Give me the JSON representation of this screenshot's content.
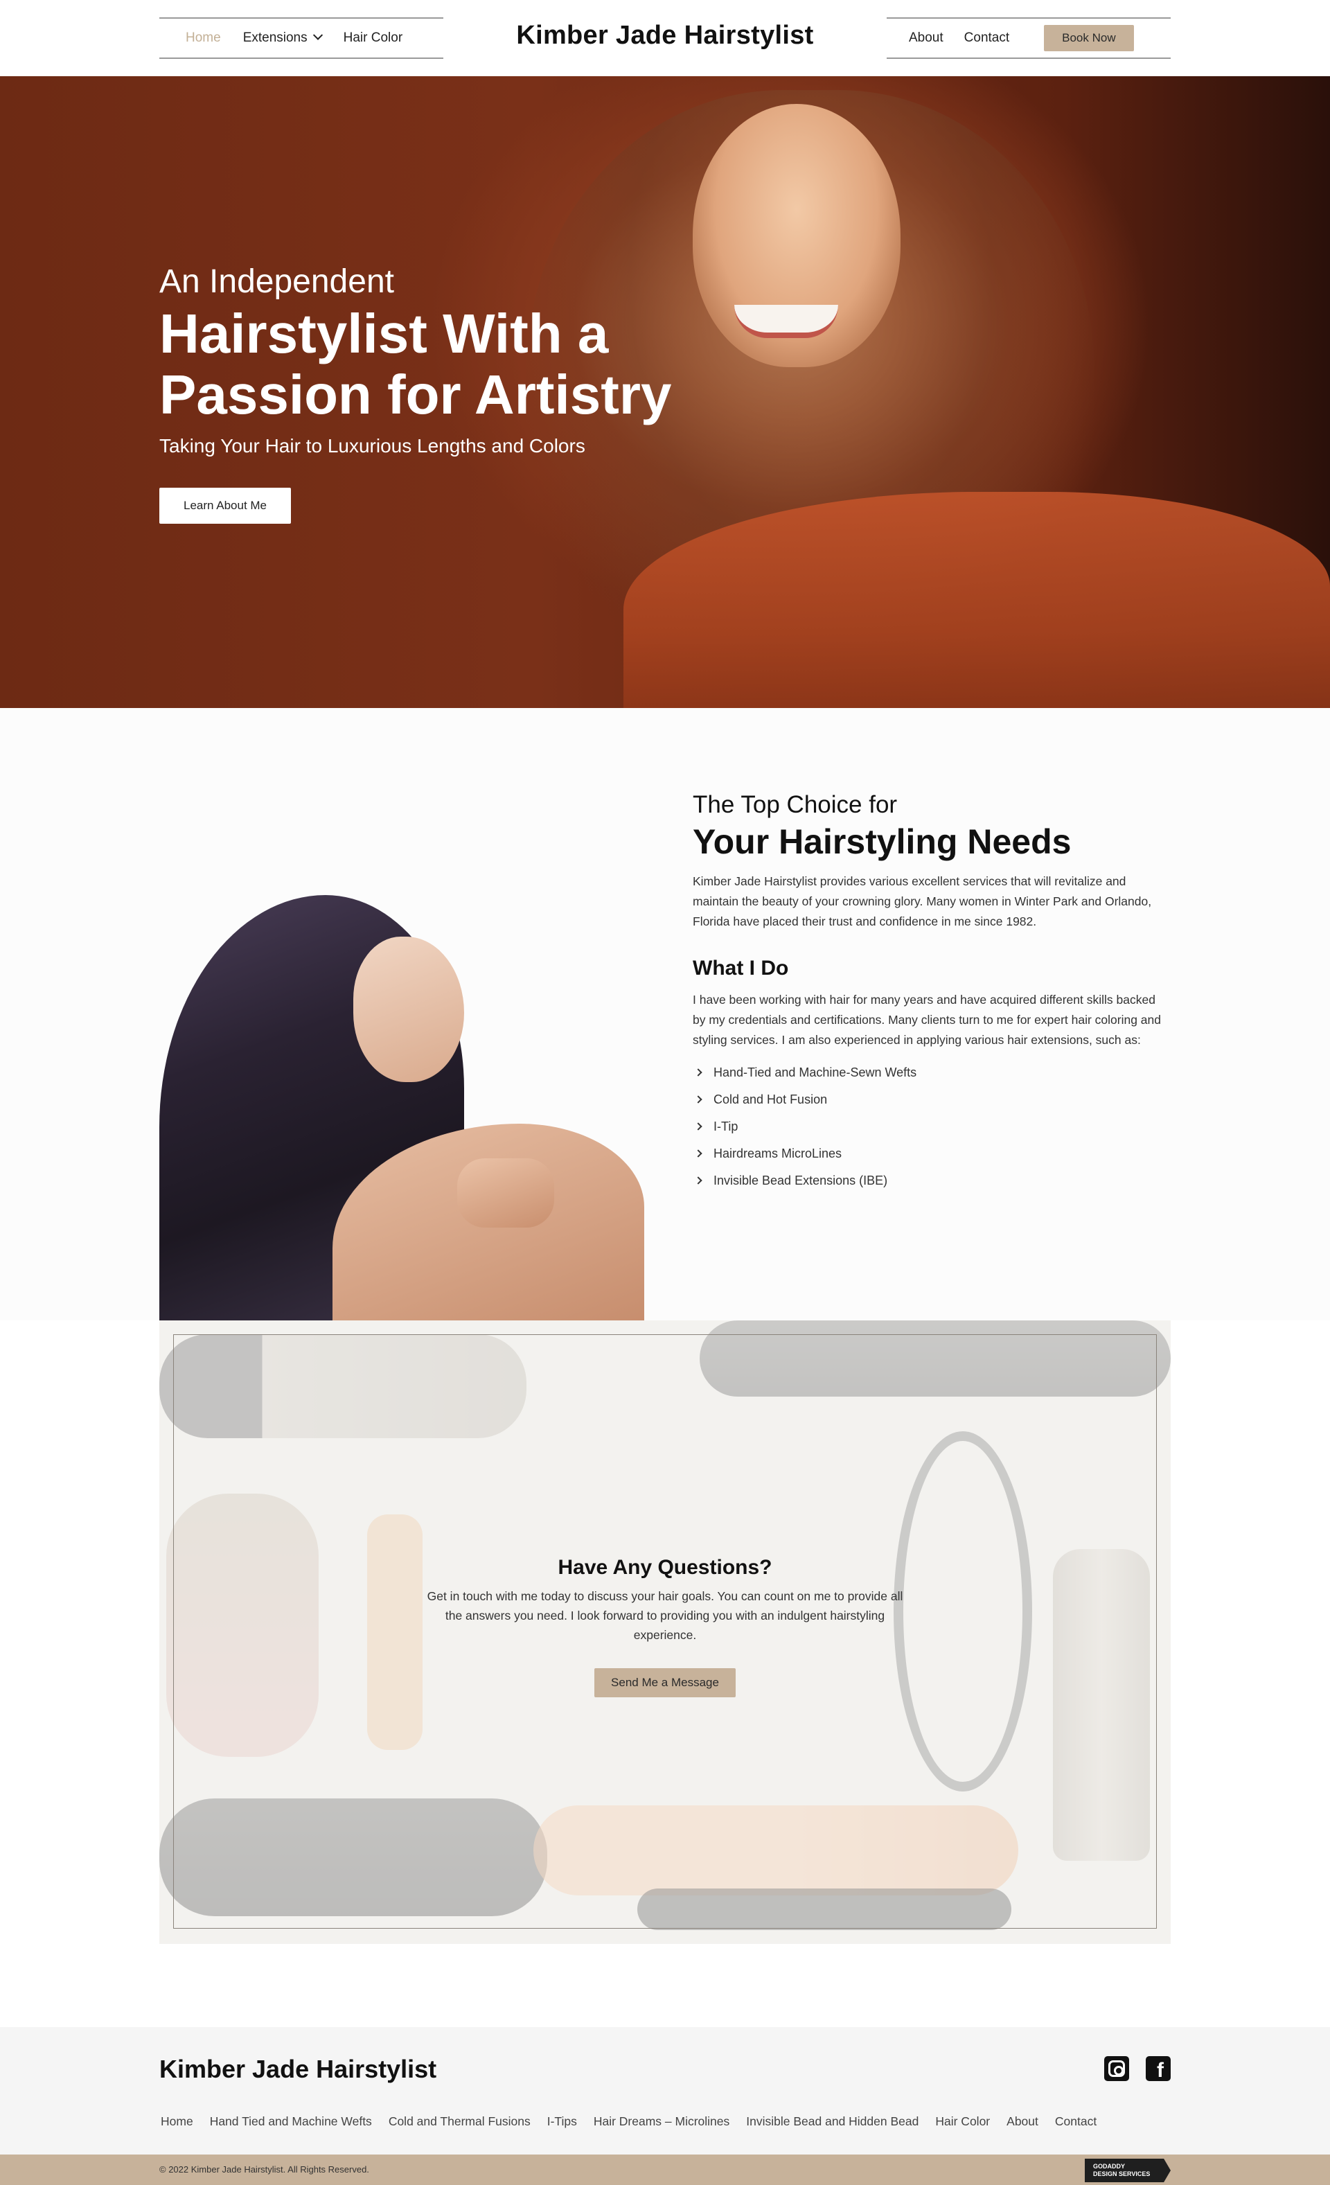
{
  "header": {
    "brand": "Kimber Jade Hairstylist",
    "nav_left": [
      {
        "label": "Home",
        "active": true
      },
      {
        "label": "Extensions",
        "has_dropdown": true
      },
      {
        "label": "Hair Color"
      }
    ],
    "nav_right": [
      {
        "label": "About"
      },
      {
        "label": "Contact"
      }
    ],
    "book_button": "Book Now"
  },
  "hero": {
    "eyebrow": "An Independent",
    "title": "Hairstylist With a Passion for Artistry",
    "subtitle": "Taking Your Hair to Luxurious Lengths and Colors",
    "button": "Learn About Me"
  },
  "about": {
    "eyebrow": "The Top Choice for",
    "title": "Your Hairstyling Needs",
    "intro": "Kimber Jade Hairstylist provides various excellent services that will revitalize and maintain the beauty of your crowning glory. Many women in Winter Park and Orlando, Florida have placed their trust and confidence in me since 1982.",
    "what_title": "What I Do",
    "what_text": "I have been working with hair for many years and have acquired different skills backed by my credentials and certifications. Many clients turn to me for expert hair coloring and styling services. I am also experienced in applying various hair extensions, such as:",
    "services": [
      "Hand-Tied and Machine-Sewn Wefts",
      "Cold and Hot Fusion",
      "I-Tip",
      "Hairdreams MicroLines",
      "Invisible Bead Extensions (IBE)"
    ]
  },
  "questions": {
    "title": "Have Any Questions?",
    "text": "Get in touch with me today to discuss your hair goals. You can count on me to provide all the answers you need. I look forward to providing you with an indulgent hairstyling experience.",
    "button": "Send Me a Message"
  },
  "footer": {
    "brand": "Kimber Jade Hairstylist",
    "social": [
      "instagram-icon",
      "facebook-icon"
    ],
    "links": [
      "Home",
      "Hand Tied and Machine Wefts",
      "Cold and Thermal Fusions",
      "I-Tips",
      "Hair Dreams – Microlines",
      "Invisible Bead and Hidden Bead",
      "Hair Color",
      "About",
      "Contact"
    ],
    "copyright": "© 2022 Kimber Jade Hairstylist. All Rights Reserved.",
    "badge_line1": "GODADDY",
    "badge_line2": "DESIGN SERVICES"
  },
  "colors": {
    "accent": "#c7b29a",
    "active_nav": "#c3b096",
    "hero_bg": "#7a3018",
    "footer_bg": "#f5f5f5"
  }
}
